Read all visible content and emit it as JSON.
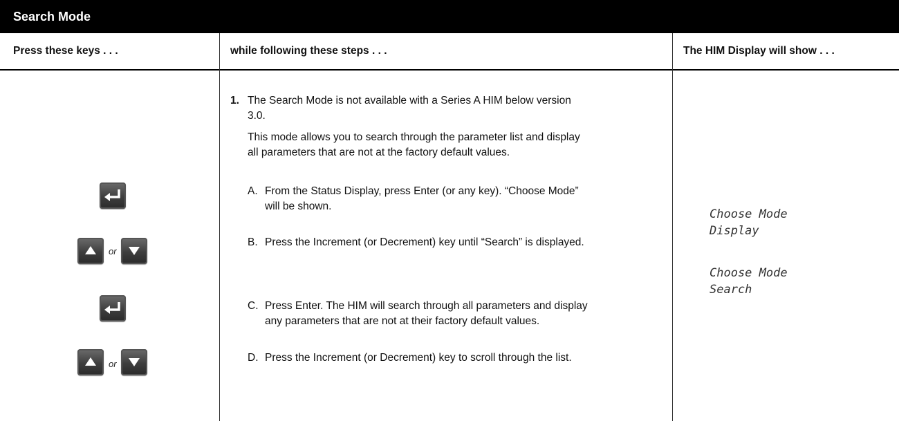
{
  "title": "Search Mode",
  "headers": {
    "keys": "Press these keys . . .",
    "steps": "while following these steps . . .",
    "display": "The HIM Display will show . . ."
  },
  "step1": {
    "number": "1.",
    "line1": "The Search Mode is not available with a Series A HIM below version",
    "line2": "3.0.",
    "para_line1": "This mode allows you to search through the parameter list and display",
    "para_line2": "all parameters that are not at the factory default values."
  },
  "substeps": [
    {
      "letter": "A.",
      "line1": "From the Status Display, press Enter (or any key). “Choose Mode”",
      "line2": "will be shown."
    },
    {
      "letter": "B.",
      "line1": "Press the Increment (or Decrement) key until “Search” is displayed.",
      "line2": ""
    },
    {
      "letter": "C.",
      "line1": "Press Enter. The HIM will search through all parameters and display",
      "line2": "any parameters that are not at their factory default values."
    },
    {
      "letter": "D.",
      "line1": "Press the Increment (or Decrement) key to scroll through the list.",
      "line2": ""
    }
  ],
  "display": [
    {
      "line1": "Choose Mode",
      "line2": "Display"
    },
    {
      "line1": "Choose Mode",
      "line2": "Search"
    }
  ],
  "keys": {
    "or_label": "or",
    "enter_icon": "enter-key-icon",
    "increment_icon": "increment-key-icon",
    "decrement_icon": "decrement-key-icon"
  }
}
